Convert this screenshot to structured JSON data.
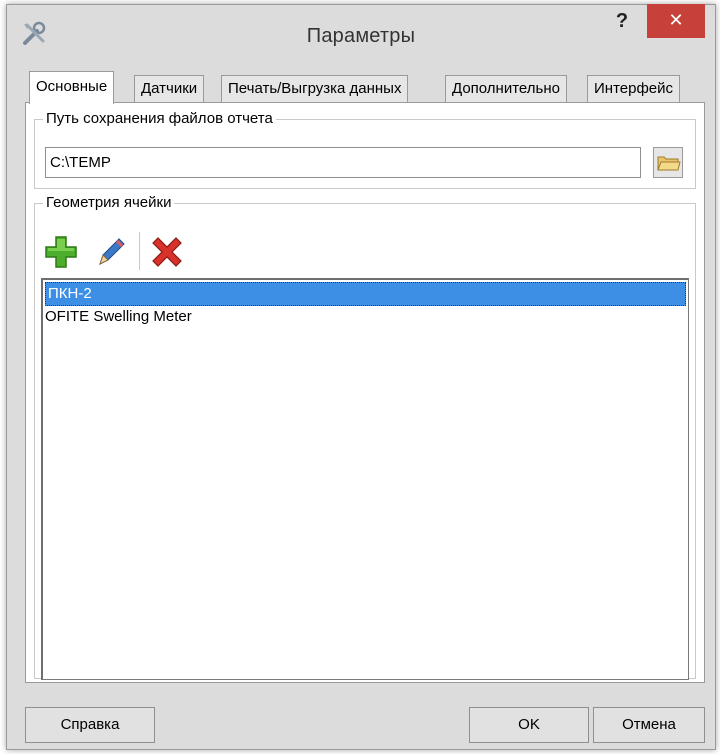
{
  "window": {
    "title": "Параметры",
    "help_label": "?",
    "close_label": "✕"
  },
  "tabs": [
    {
      "label": "Основные",
      "active": true
    },
    {
      "label": "Датчики",
      "active": false
    },
    {
      "label": "Печать/Выгрузка данных",
      "active": false
    },
    {
      "label": "Дополнительно",
      "active": false
    },
    {
      "label": "Интерфейс",
      "active": false
    }
  ],
  "report_path": {
    "group_title": "Путь сохранения файлов отчета",
    "value": "C:\\TEMP",
    "browse_icon": "folder-icon"
  },
  "cell_geometry": {
    "group_title": "Геометрия ячейки",
    "toolbar": {
      "add_icon": "plus-icon",
      "edit_icon": "pencil-icon",
      "delete_icon": "delete-x-icon"
    },
    "items": [
      {
        "label": "ПКН-2",
        "selected": true
      },
      {
        "label": "OFITE Swelling Meter",
        "selected": false
      }
    ]
  },
  "buttons": {
    "help": "Справка",
    "ok": "OK",
    "cancel": "Отмена"
  },
  "colors": {
    "selection": "#3d8fe6",
    "close_button": "#c7413a",
    "window_bg": "#dcdcdc"
  }
}
